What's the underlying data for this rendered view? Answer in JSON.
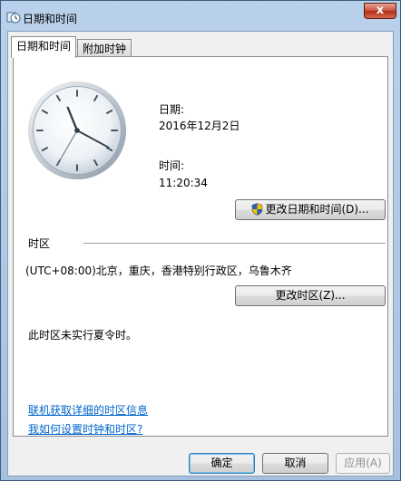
{
  "window": {
    "title": "日期和时间",
    "title_icon": "clock-app-icon",
    "close_glyph": "x"
  },
  "tabs": [
    {
      "label": "日期和时间",
      "active": true
    },
    {
      "label": "附加时钟",
      "active": false
    }
  ],
  "datetime": {
    "date_label": "日期:",
    "date_value": "2016年12月2日",
    "time_label": "时间:",
    "time_value": "11:20:34",
    "change_button": "更改日期和时间(D)...",
    "change_button_icon": "uac-shield-icon"
  },
  "timezone": {
    "section_label": "时区",
    "value": "(UTC+08:00)北京，重庆，香港特别行政区，乌鲁木齐",
    "change_button": "更改时区(Z)...",
    "dst_note": "此时区未实行夏令时。"
  },
  "links": {
    "online_info": "联机获取详细的时区信息",
    "how_to": "我如何设置时钟和时区?"
  },
  "footer": {
    "ok": "确定",
    "cancel": "取消",
    "apply": "应用(A)"
  },
  "colors": {
    "link": "#0066cc",
    "title_gradient_top": "#b9d1ea",
    "close_button": "#c7503b"
  }
}
